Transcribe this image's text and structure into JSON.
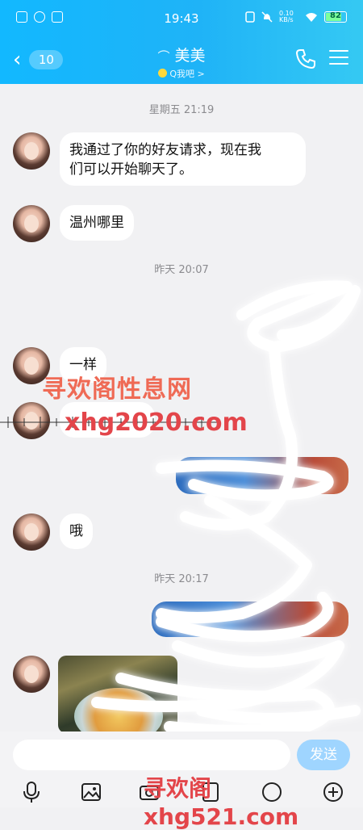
{
  "status_bar": {
    "time": "19:43",
    "net_speed": "0.10 KB/s",
    "battery": "82",
    "battery_level": 0.82
  },
  "header": {
    "back_badge": "10",
    "title": "美美",
    "subtitle": "Q我吧 >"
  },
  "chat": {
    "timestamps": [
      "星期五 21:19",
      "昨天 20:07",
      "昨天 20:17"
    ],
    "messages": [
      {
        "text": "我通过了你的好友请求，现在我们可以开始聊天了。",
        "line1": "我通过了你的好友请求，现在我",
        "line2": "们可以开始聊天了。"
      },
      {
        "text": "温州哪里"
      },
      {
        "text": "一样"
      },
      {
        "text": "哦"
      }
    ]
  },
  "watermarks": {
    "text1": "寻欢阁性息网",
    "text2": "xhg2020.com",
    "text3": "寻欢阁xhg521.com"
  },
  "input": {
    "placeholder": "",
    "send_label": "发送"
  },
  "colors": {
    "header_start": "#12b8ff",
    "header_end": "#35c9f3",
    "send_button": "#9fd5ff",
    "background": "#f1f1f3"
  },
  "icons": {
    "phone": "phone-icon",
    "menu": "menu-icon",
    "voice": "microphone-icon",
    "image": "image-icon",
    "add": "plus-icon"
  }
}
